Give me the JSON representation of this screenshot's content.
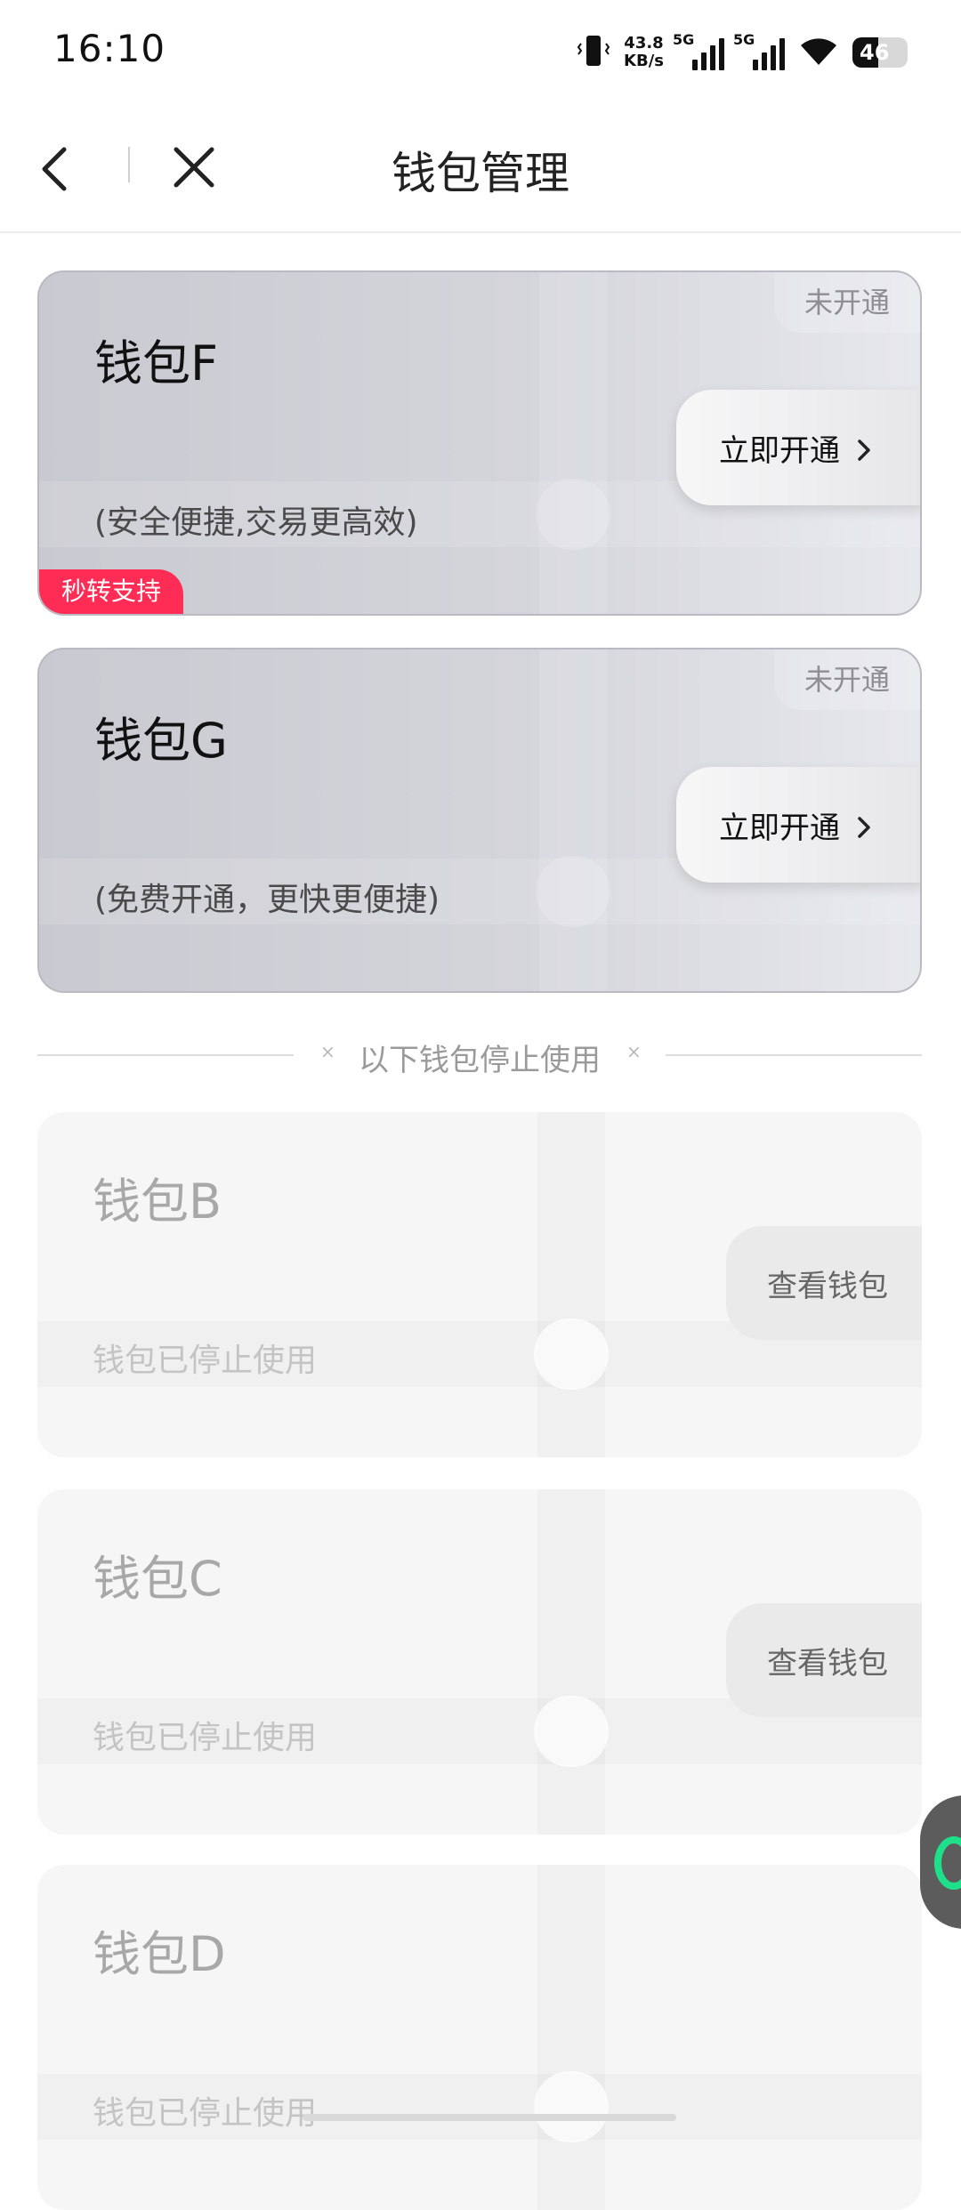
{
  "status_bar": {
    "time": "16:10",
    "net_speed_value": "43.8",
    "net_speed_unit": "KB/s",
    "sim1_label": "5G",
    "sim2_label": "5G",
    "battery_level": "46",
    "icons": [
      "vibrate-icon",
      "signal-icon",
      "wifi-icon",
      "battery-icon"
    ]
  },
  "nav": {
    "title": "钱包管理",
    "back_icon": "chevron-left-icon",
    "close_icon": "close-icon"
  },
  "active_wallets": [
    {
      "name": "钱包F",
      "description": "(安全便捷,交易更高效)",
      "status": "未开通",
      "button_label": "立即开通",
      "badge": "秒转支持"
    },
    {
      "name": "钱包G",
      "description": "(免费开通，更快更便捷)",
      "status": "未开通",
      "button_label": "立即开通"
    }
  ],
  "divider_text": "以下钱包停止使用",
  "inactive_wallets": [
    {
      "name": "钱包B",
      "description": "钱包已停止使用",
      "button_label": "查看钱包"
    },
    {
      "name": "钱包C",
      "description": "钱包已停止使用",
      "button_label": "查看钱包"
    },
    {
      "name": "钱包D",
      "description": "钱包已停止使用"
    }
  ],
  "colors": {
    "badge": "#ff2d55",
    "float_button_accent": "#1ee08a"
  }
}
